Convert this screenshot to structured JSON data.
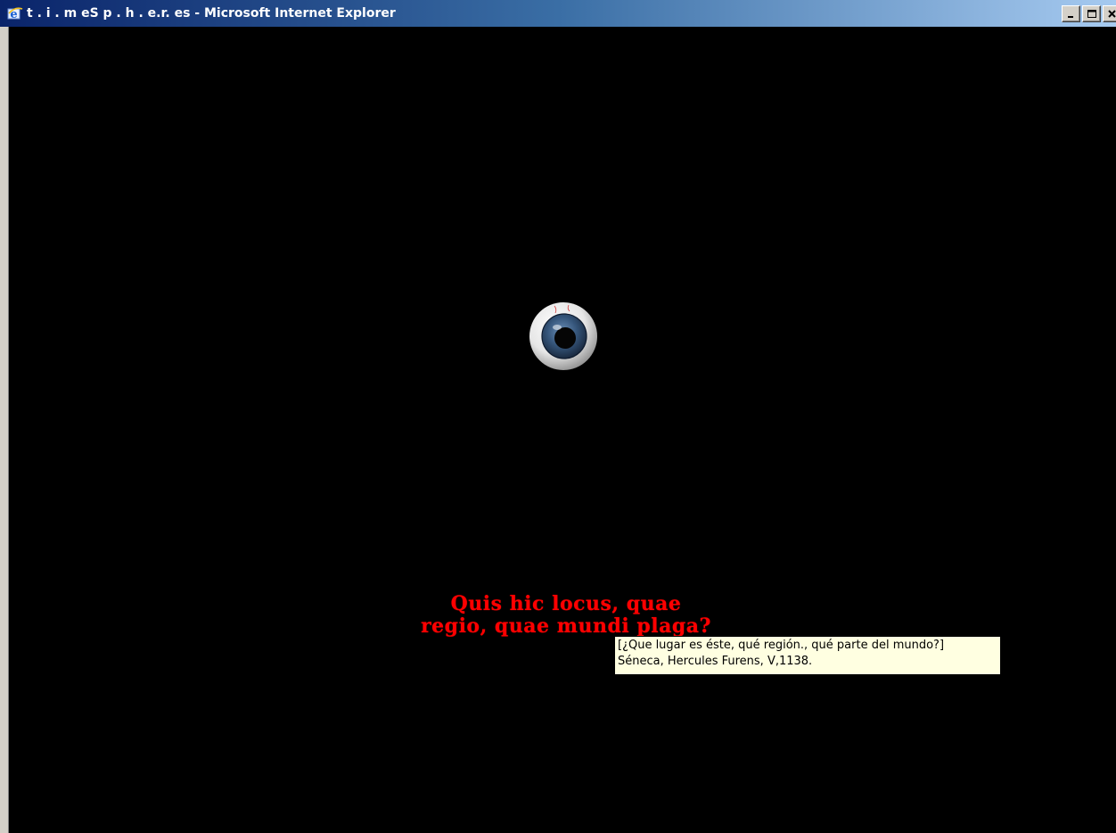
{
  "window": {
    "title": "t . i . m eS p . h . e.r. es - Microsoft Internet Explorer",
    "icon": "ie-icon",
    "controls": [
      "minimize-icon",
      "maximize-icon",
      "close-icon"
    ]
  },
  "page": {
    "background": "#000000",
    "image": "eyeball-icon",
    "quote": {
      "line1": "Quis hic locus, quae",
      "line2": "regio, quae mundi plaga?",
      "color": "#ff0000"
    },
    "tooltip": {
      "line1": "[¿Que lugar es éste, qué región., qué parte del mundo?]",
      "line2": "Séneca, Hercules Furens, V,1138."
    }
  }
}
